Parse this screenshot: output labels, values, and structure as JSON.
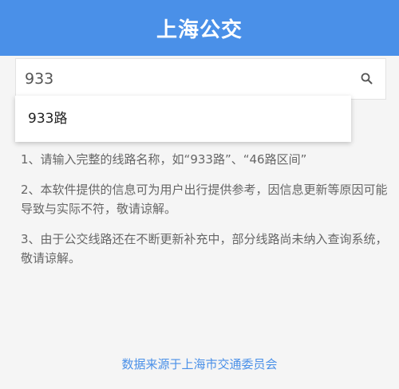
{
  "header": {
    "title": "上海公交"
  },
  "search": {
    "value": "933",
    "icon": "search-icon"
  },
  "suggestions": [
    {
      "label": "933路"
    }
  ],
  "tips": [
    "1、请输入完整的线路名称，如“933路”、“46路区间”",
    "2、本软件提供的信息可为用户出行提供参考，因信息更新等原因可能导致与实际不符，敬请谅解。",
    "3、由于公交线路还在不断更新补充中，部分线路尚未纳入查询系统，敬请谅解。"
  ],
  "footer": {
    "source_link": "数据来源于上海市交通委员会"
  },
  "colors": {
    "accent": "#4a90e8",
    "background": "#f5f5f5"
  }
}
